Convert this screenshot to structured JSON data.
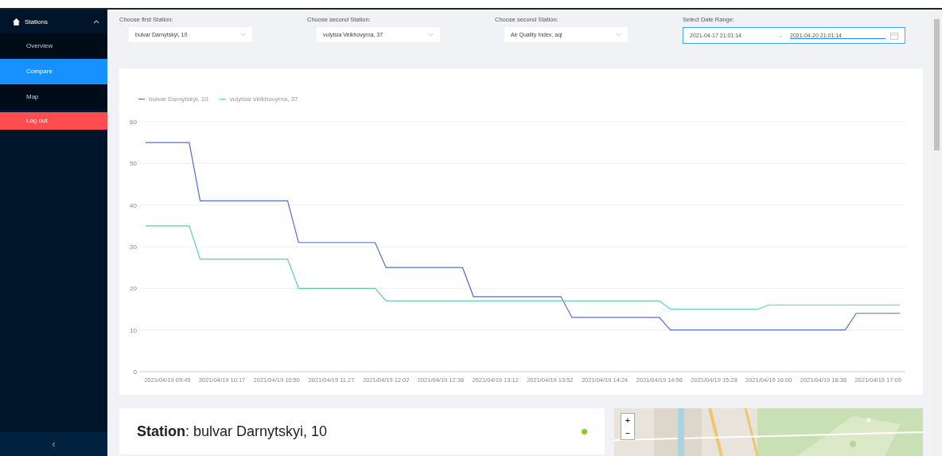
{
  "sidebar": {
    "group": {
      "label": "Stations",
      "expanded": true
    },
    "items": [
      {
        "label": "Overview",
        "selected": false,
        "kind": "nav"
      },
      {
        "label": "Compare",
        "selected": true,
        "kind": "nav"
      },
      {
        "label": "Map",
        "selected": false,
        "kind": "nav"
      },
      {
        "label": "Log out",
        "selected": false,
        "kind": "danger"
      }
    ]
  },
  "filters": [
    {
      "label": "Choose first Station:",
      "value": "bulvar Darnytskyi, 10"
    },
    {
      "label": "Choose second Station:",
      "value": "vulytsia Velkhovyrna, 37"
    },
    {
      "label": "Choose second Station:",
      "value": "Air Quality Index, aqi"
    }
  ],
  "date_range": {
    "label": "Select Date Range:",
    "start": "2021-04-17 21:01:14",
    "separator": "→",
    "end": "2021-04-20 21:01:14"
  },
  "chart": {
    "chart_data": {
      "type": "line",
      "categories": [
        null,
        null,
        "2021/04/19 09:45",
        null,
        null,
        null,
        null,
        "2021/04/19 10:17",
        null,
        null,
        null,
        null,
        "2021/04/19 10:50",
        null,
        null,
        null,
        null,
        "2021/04/19 11:27",
        null,
        null,
        null,
        null,
        "2021/04/19 12:02",
        null,
        null,
        null,
        null,
        "2021/04/19 12:36",
        null,
        null,
        null,
        null,
        "2021/04/19 13:12",
        null,
        null,
        null,
        null,
        "2021/04/19 13:52",
        null,
        null,
        null,
        null,
        "2021/04/19 14:24",
        null,
        null,
        null,
        null,
        "2021/04/19 14:56",
        null,
        null,
        null,
        null,
        "2021/04/19 15:28",
        null,
        null,
        null,
        null,
        "2021/04/19 16:00",
        null,
        null,
        null,
        null,
        "2021/04/19 16:36",
        null,
        null,
        null,
        null,
        "2021/04/19 17:09",
        null,
        null
      ],
      "grid": true,
      "ylim": [
        0,
        60
      ],
      "yticks": [
        0,
        10,
        20,
        30,
        40,
        50,
        60
      ],
      "series": [
        {
          "name": "bulvar Darnytskyi, 10",
          "color": "#5470c6",
          "values": [
            55,
            55,
            55,
            55,
            55,
            41,
            41,
            41,
            41,
            41,
            41,
            41,
            41,
            41,
            31,
            31,
            31,
            31,
            31,
            31,
            31,
            31,
            25,
            25,
            25,
            25,
            25,
            25,
            25,
            25,
            18,
            18,
            18,
            18,
            18,
            18,
            18,
            18,
            18,
            13,
            13,
            13,
            13,
            13,
            13,
            13,
            13,
            13,
            10,
            10,
            10,
            10,
            10,
            10,
            10,
            10,
            10,
            10,
            10,
            10,
            10,
            10,
            10,
            10,
            10,
            14,
            14,
            14,
            14,
            14
          ]
        },
        {
          "name": "vulytsia Velkhovyrna, 37",
          "color": "#5ed0a8",
          "values": [
            35,
            35,
            35,
            35,
            35,
            27,
            27,
            27,
            27,
            27,
            27,
            27,
            27,
            27,
            20,
            20,
            20,
            20,
            20,
            20,
            20,
            20,
            17,
            17,
            17,
            17,
            17,
            17,
            17,
            17,
            17,
            17,
            17,
            17,
            17,
            17,
            17,
            17,
            17,
            17,
            17,
            17,
            17,
            17,
            17,
            17,
            17,
            17,
            15,
            15,
            15,
            15,
            15,
            15,
            15,
            15,
            15,
            16,
            16,
            16,
            16,
            16,
            16,
            16,
            16,
            16,
            16,
            16,
            16,
            16
          ]
        }
      ]
    }
  },
  "station": {
    "title": "**Station**: bulvar Darnytskyi, 10",
    "online": true
  },
  "map": {
    "kind": "picture",
    "zoom_in": "+",
    "zoom_out": "−"
  },
  "sidebar_footer": {
    "collapse": "‹"
  }
}
